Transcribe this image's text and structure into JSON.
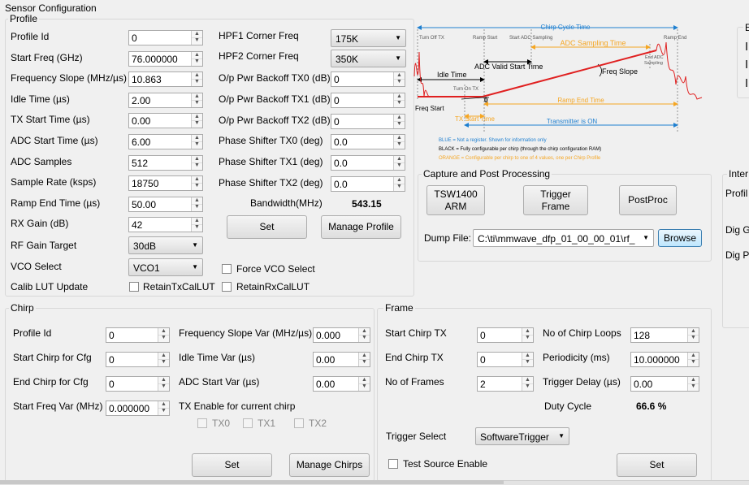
{
  "window_title": "Sensor Configuration",
  "profile": {
    "title": "Profile",
    "left_fields": [
      {
        "label": "Profile Id",
        "value": "0"
      },
      {
        "label": "Start Freq (GHz)",
        "value": "76.000000"
      },
      {
        "label": "Frequency Slope (MHz/µs)",
        "value": "10.863"
      },
      {
        "label": "Idle Time (µs)",
        "value": "2.00"
      },
      {
        "label": "TX Start Time (µs)",
        "value": "0.00"
      },
      {
        "label": "ADC Start Time (µs)",
        "value": "6.00"
      },
      {
        "label": "ADC Samples",
        "value": "512"
      },
      {
        "label": "Sample Rate (ksps)",
        "value": "18750"
      },
      {
        "label": "Ramp End Time (µs)",
        "value": "50.00"
      },
      {
        "label": "RX Gain (dB)",
        "value": "42"
      }
    ],
    "rf_gain_target": {
      "label": "RF Gain Target",
      "value": "30dB"
    },
    "vco_select": {
      "label": "VCO Select",
      "value": "VCO1"
    },
    "calib_lut_update": {
      "label": "Calib LUT Update"
    },
    "retain_tx": "RetainTxCalLUT",
    "retain_rx": "RetainRxCalLUT",
    "force_vco": "Force VCO Select",
    "hpf1": {
      "label": "HPF1 Corner Freq",
      "value": "175K"
    },
    "hpf2": {
      "label": "HPF2 Corner Freq",
      "value": "350K"
    },
    "right_fields": [
      {
        "label": "O/p Pwr Backoff TX0 (dB)",
        "value": "0"
      },
      {
        "label": "O/p Pwr Backoff TX1 (dB)",
        "value": "0"
      },
      {
        "label": "O/p Pwr Backoff TX2 (dB)",
        "value": "0"
      },
      {
        "label": "Phase Shifter TX0 (deg)",
        "value": "0.0"
      },
      {
        "label": "Phase Shifter TX1 (deg)",
        "value": "0.0"
      },
      {
        "label": "Phase Shifter TX2 (deg)",
        "value": "0.0"
      }
    ],
    "bandwidth_label": "Bandwidth(MHz)",
    "bandwidth_value": "543.15",
    "set_label": "Set",
    "manage_label": "Manage Profile"
  },
  "diagram": {
    "chirp_cycle_time": "Chirp Cycle Time",
    "turn_off_tx": "Turn Off TX",
    "ramp_start": "Ramp Start",
    "start_adc_sampling": "Start ADC Sampling",
    "adc_sampling_time": "ADC Sampling Time",
    "ramp_end": "Ramp End",
    "end_adc_sampling_1": "End ADC",
    "end_adc_sampling_2": "Sampling",
    "adc_valid_start_time": "ADC Valid Start Time",
    "idle_time": "Idle Time",
    "freq_slope": "Freq Slope",
    "turn_on_tx": "Turn On TX",
    "freq_start": "Freq Start",
    "zero": "0",
    "ramp_end_time": "Ramp End Time",
    "tx_start_time": "TX Start Time",
    "transmitter_on": "Transmitter is ON",
    "legend_blue": "BLUE = Not a register. Shown for information only",
    "legend_black": "BLACK = Fully configurable per chirp (through the chirp configuration RAM)",
    "legend_orange": "ORANGE = Configurable per chirp to one of 4 values, one per Chirp Profile",
    "colors": {
      "blue": "#1e7fd0",
      "orange": "#f5a623",
      "red": "#e02020",
      "black": "#000000"
    }
  },
  "capture": {
    "title": "Capture and Post Processing",
    "btn_tsw_1": "TSW1400",
    "btn_tsw_2": "ARM",
    "btn_trigger_1": "Trigger",
    "btn_trigger_2": "Frame",
    "btn_postproc": "PostProc",
    "dump_label": "Dump File:",
    "dump_value": "C:\\ti\\mmwave_dfp_01_00_00_01\\rf_",
    "browse_label": "Browse"
  },
  "side_panels": {
    "top_right_title": "E",
    "inter_title": "Inter",
    "labels": [
      "Profil",
      "Dig G",
      "Dig P"
    ]
  },
  "chirp": {
    "title": "Chirp",
    "left_fields": [
      {
        "label": "Profile Id",
        "value": "0"
      },
      {
        "label": "Start Chirp for Cfg",
        "value": "0"
      },
      {
        "label": "End Chirp for Cfg",
        "value": "0"
      },
      {
        "label": "Start Freq Var (MHz)",
        "value": "0.000000"
      }
    ],
    "right_fields": [
      {
        "label": "Frequency Slope Var (MHz/µs)",
        "value": "0.000"
      },
      {
        "label": "Idle Time Var (µs)",
        "value": "0.00"
      },
      {
        "label": "ADC Start Var (µs)",
        "value": "0.00"
      }
    ],
    "tx_enable_label": "TX Enable for current chirp",
    "tx0": "TX0",
    "tx1": "TX1",
    "tx2": "TX2",
    "set_label": "Set",
    "manage_label": "Manage Chirps"
  },
  "frame": {
    "title": "Frame",
    "left_fields": [
      {
        "label": "Start Chirp TX",
        "value": "0"
      },
      {
        "label": "End Chirp TX",
        "value": "0"
      },
      {
        "label": "No of Frames",
        "value": "2"
      }
    ],
    "right_fields": [
      {
        "label": "No of Chirp Loops",
        "value": "128"
      },
      {
        "label": "Periodicity (ms)",
        "value": "10.000000"
      },
      {
        "label": "Trigger Delay (µs)",
        "value": "0.00"
      }
    ],
    "duty_label": "Duty Cycle",
    "duty_value": "66.6 %",
    "trigger_label": "Trigger Select",
    "trigger_value": "SoftwareTrigger",
    "test_source": "Test Source Enable",
    "set_label": "Set"
  }
}
